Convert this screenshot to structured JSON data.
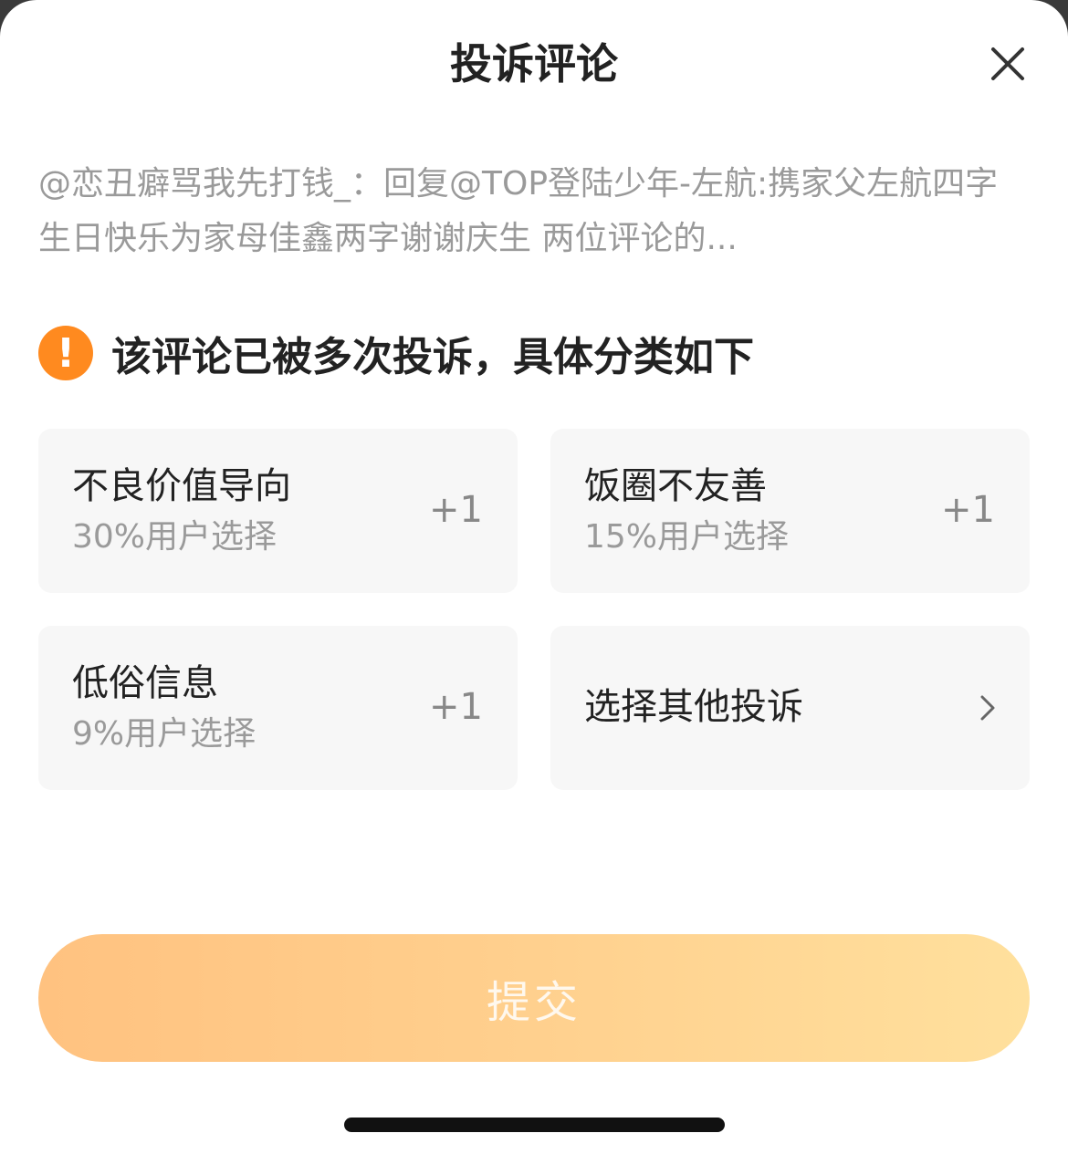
{
  "dialog": {
    "title": "投诉评论",
    "close_icon": "close-icon"
  },
  "comment": {
    "text": "@恋丑癖骂我先打钱_：回复@TOP登陆少年-左航:携家父左航四字生日快乐为家母佳鑫两字谢谢庆生 两位评论的..."
  },
  "notice": {
    "icon": "warning-icon",
    "icon_glyph": "!",
    "text": "该评论已被多次投诉，具体分类如下"
  },
  "options": [
    {
      "name": "不良价值导向",
      "percent": "30%用户选择",
      "plus": "+1"
    },
    {
      "name": "饭圈不友善",
      "percent": "15%用户选择",
      "plus": "+1"
    },
    {
      "name": "低俗信息",
      "percent": "9%用户选择",
      "plus": "+1"
    }
  ],
  "other": {
    "label": "选择其他投诉",
    "icon": "chevron-right-icon"
  },
  "submit": {
    "label": "提交"
  },
  "colors": {
    "accent_orange": "#ff8a1f",
    "button_gradient_start": "#ffc280",
    "button_gradient_end": "#ffe09d",
    "card_bg": "#f7f7f7"
  }
}
